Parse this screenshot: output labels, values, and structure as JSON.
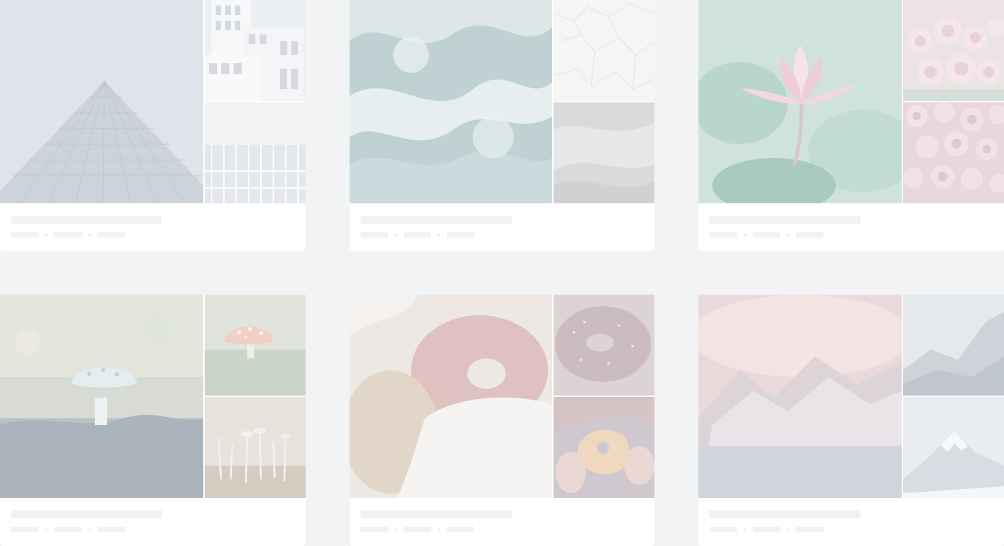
{
  "gallery": {
    "cards": [
      {
        "theme": "architecture",
        "images": [
          "pyramid-glass-building",
          "white-modular-building",
          "glass-facade-building"
        ]
      },
      {
        "theme": "water-texture",
        "images": [
          "ocean-waves",
          "cracked-white-texture",
          "grey-marble-texture"
        ]
      },
      {
        "theme": "flowers",
        "images": [
          "pink-water-lily",
          "pink-roses-bouquet",
          "pink-roses-field"
        ]
      },
      {
        "theme": "mushrooms",
        "images": [
          "white-mushroom-forest",
          "red-spotted-mushroom",
          "thin-white-mushrooms"
        ]
      },
      {
        "theme": "donuts",
        "images": [
          "sugar-donut-closeup",
          "chocolate-glazed-donut",
          "bitten-donut-hands"
        ]
      },
      {
        "theme": "mountains",
        "images": [
          "pink-cloud-mountain",
          "misty-mountain-ridge",
          "snowy-mountain-peak"
        ]
      }
    ]
  }
}
